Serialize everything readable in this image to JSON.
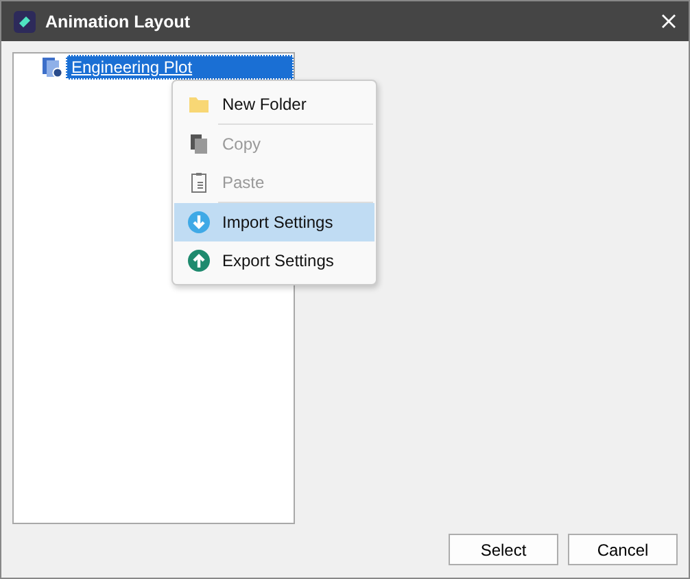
{
  "window": {
    "title": "Animation Layout"
  },
  "tree": {
    "items": [
      {
        "label": "Engineering Plot",
        "selected": true
      }
    ]
  },
  "context_menu": {
    "items": [
      {
        "kind": "folder",
        "label": "New Folder",
        "disabled": false,
        "selected": false
      },
      {
        "kind": "separator"
      },
      {
        "kind": "copy",
        "label": "Copy",
        "disabled": true,
        "selected": false
      },
      {
        "kind": "paste",
        "label": "Paste",
        "disabled": true,
        "selected": false
      },
      {
        "kind": "separator"
      },
      {
        "kind": "import",
        "label": "Import Settings",
        "disabled": false,
        "selected": true
      },
      {
        "kind": "export",
        "label": "Export Settings",
        "disabled": false,
        "selected": false
      }
    ]
  },
  "buttons": [
    "Select",
    "Cancel"
  ]
}
